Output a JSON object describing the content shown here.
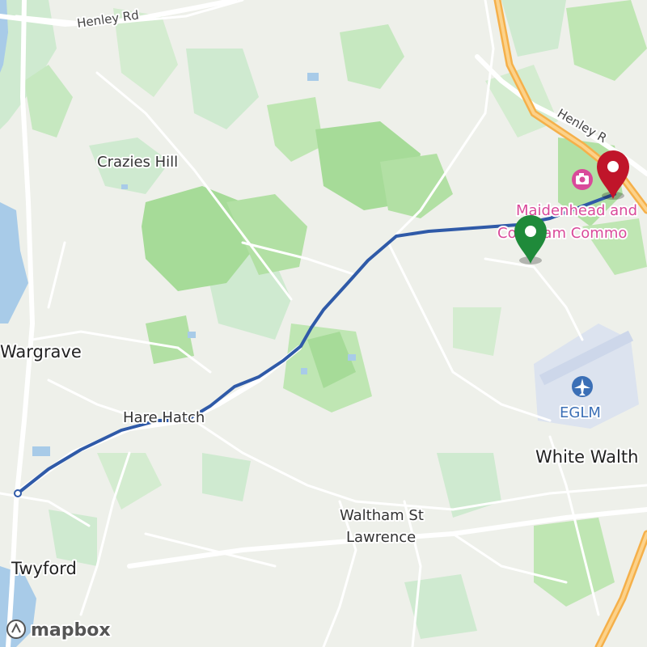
{
  "map": {
    "labels": {
      "henley_rd_nw": "Henley Rd",
      "henley_rd_ne": "Henley R",
      "crazies_hill": "Crazies Hill",
      "wargrave": "Wargrave",
      "hare_hatch": "Hare Hatch",
      "waltham_st_lawrence_1": "Waltham St",
      "waltham_st_lawrence_2": "Lawrence",
      "twyford": "Twyford",
      "white_waltham": "White Walth",
      "eglm": "EGLM",
      "poi_line1": "Maidenhead and",
      "poi_line2": "Cookham Commo"
    },
    "attribution": "mapbox",
    "colors": {
      "land": "#eef0ea",
      "park": "#bfe6b3",
      "forest": "#a6db98",
      "water": "#a8cbe8",
      "road": "#ffffff",
      "motorway": "#f5b04a",
      "route": "#2f5aa8",
      "start_marker": "#1f8a3a",
      "end_marker": "#c0152a",
      "poi": "#d94a9a",
      "airport": "#3b6fb6"
    },
    "markers": {
      "start_icon": "map-pin-green",
      "end_icon": "map-pin-red"
    }
  }
}
